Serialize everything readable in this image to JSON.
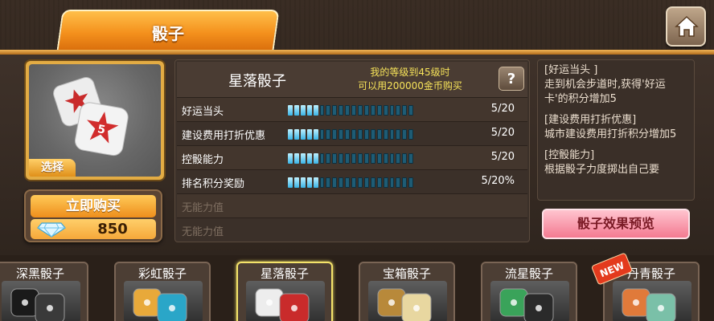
{
  "tab": {
    "label": "骰子"
  },
  "dice": {
    "name": "星落骰子",
    "requirement": [
      "我的等级到45级时",
      "可以用200000金币购买"
    ],
    "select_label": "选择",
    "help_label": "?"
  },
  "buy": {
    "label": "立即购买",
    "price": "850"
  },
  "attributes": [
    {
      "label": "好运当头",
      "value": "5/20",
      "level": 5,
      "max": 20,
      "enabled": true
    },
    {
      "label": "建设费用打折优惠",
      "value": "5/20",
      "level": 5,
      "max": 20,
      "enabled": true
    },
    {
      "label": "控骰能力",
      "value": "5/20",
      "level": 5,
      "max": 20,
      "enabled": true
    },
    {
      "label": "排名积分奖励",
      "value": "5/20%",
      "level": 5,
      "max": 20,
      "enabled": true
    },
    {
      "label": "无能力值",
      "enabled": false
    },
    {
      "label": "无能力值",
      "enabled": false
    }
  ],
  "description": [
    "[好运当头 ]\n走到机会步道时,获得'好运卡'的积分增加5",
    "[建设费用打折优惠]\n城市建设费用打折积分增加5",
    "[控骰能力]\n根据骰子力度掷出自己要"
  ],
  "preview_button": "骰子效果预览",
  "cards": [
    {
      "name": "深黑骰子",
      "active": false
    },
    {
      "name": "彩虹骰子",
      "active": false
    },
    {
      "name": "星落骰子",
      "active": true
    },
    {
      "name": "宝箱骰子",
      "active": false
    },
    {
      "name": "流星骰子",
      "active": false
    },
    {
      "name": "丹青骰子",
      "active": false,
      "badge": "NEW"
    }
  ],
  "colors": {
    "accent": "#f4901c",
    "bar": "#39b4e6",
    "req_text": "#f7e35a"
  },
  "icons": {
    "home": "home-icon",
    "gem": "diamond-icon",
    "help": "question-icon"
  }
}
